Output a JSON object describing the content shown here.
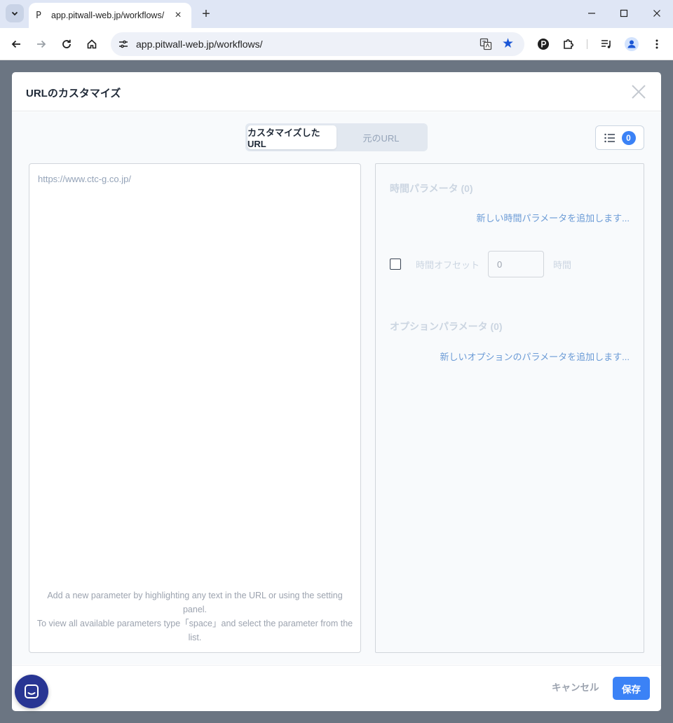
{
  "browser": {
    "tab_title": "app.pitwall-web.jp/workflows/",
    "tab_favicon": "P",
    "url": "app.pitwall-web.jp/workflows/"
  },
  "modal": {
    "title": "URLのカスタマイズ",
    "tabs": [
      {
        "label": "カスタマイズしたURL",
        "active": true
      },
      {
        "label": "元のURL",
        "active": false
      }
    ],
    "param_count": "0",
    "url_value": "https://www.ctc-g.co.jp/",
    "hint_line1": "Add a new parameter by highlighting any text in the URL or using the setting panel.",
    "hint_line2": "To view all available parameters type「space」and select the parameter from the list.",
    "time_params": {
      "title": "時間パラメータ (0)",
      "add_link": "新しい時間パラメータを追加します..."
    },
    "time_offset": {
      "label": "時間オフセット",
      "value": "0",
      "unit": "時間"
    },
    "option_params": {
      "title": "オプションパラメータ (0)",
      "add_link": "新しいオプションのパラメータを追加します..."
    },
    "footer": {
      "cancel": "キャンセル",
      "save": "保存"
    }
  },
  "colors": {
    "accent": "#3b82f6",
    "chat": "#283593",
    "backdrop": "#6b7582"
  }
}
